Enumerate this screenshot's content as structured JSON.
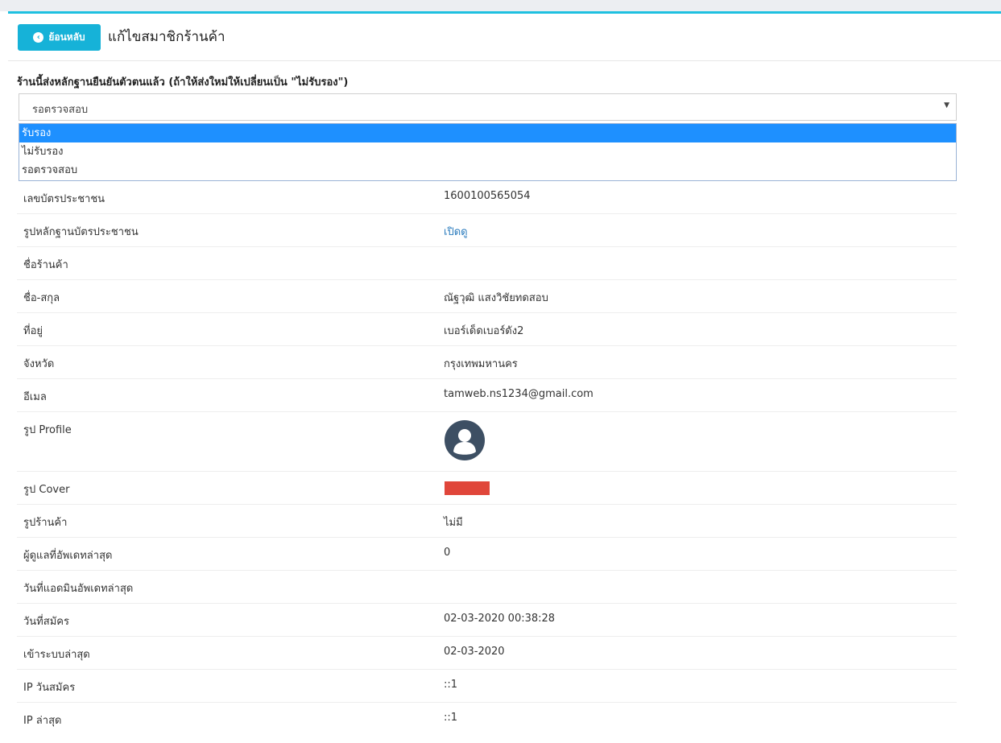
{
  "header": {
    "back_label": "ย้อนหลับ",
    "title": "แก้ไขสมาชิกร้านค้า"
  },
  "verification": {
    "label": "ร้านนี้ส่งหลักฐานยืนยันตัวตนแล้ว (ถ้าให้ส่งใหม่ให้เปลี่ยนเป็น \"ไม่รับรอง\")",
    "selected": "รอตรวจสอบ",
    "options": [
      "รับรอง",
      "ไม่รับรอง",
      "รอตรวจสอบ"
    ],
    "highlighted_option": "รับรอง"
  },
  "fields": [
    {
      "label": "เลขบัตรประชาชน",
      "value": "1600100565054"
    },
    {
      "label": "รูปหลักฐานบัตรประชาชน",
      "value": "เปิดดู"
    },
    {
      "label": "ชื่อร้านค้า",
      "value": ""
    },
    {
      "label": "ชื่อ-สกุล",
      "value": "ณัฐวุฒิ แสงวิชัยทดสอบ"
    },
    {
      "label": "ที่อยู่",
      "value": "เบอร์เด็ดเบอร์ดัง2"
    },
    {
      "label": "จังหวัด",
      "value": "กรุงเทพมหานคร"
    },
    {
      "label": "อีเมล",
      "value": "tamweb.ns1234@gmail.com"
    },
    {
      "label": "รูป Profile",
      "value": ""
    },
    {
      "label": "รูป Cover",
      "value": ""
    },
    {
      "label": "รูปร้านค้า",
      "value": "ไม่มี"
    },
    {
      "label": "ผู้ดูแลที่อัพเดทล่าสุด",
      "value": "0"
    },
    {
      "label": "วันที่แอดมินอัพเดทล่าสุด",
      "value": ""
    },
    {
      "label": "วันที่สมัคร",
      "value": "02-03-2020 00:38:28"
    },
    {
      "label": "เข้าระบบล่าสุด",
      "value": "02-03-2020"
    },
    {
      "label": "IP วันสมัคร",
      "value": "::1"
    },
    {
      "label": "IP ล่าสุด",
      "value": "::1"
    }
  ],
  "icons": {
    "back": "chevron-left-circle-icon",
    "avatar": "user-avatar-icon",
    "select_arrow": "caret-down-icon"
  },
  "colors": {
    "accent": "#16b2d8",
    "top_border": "#1ec0e0",
    "option_highlight": "#1e90ff",
    "link": "#2a7bbd",
    "avatar": "#3d4f63",
    "cover": "#e0463a"
  }
}
